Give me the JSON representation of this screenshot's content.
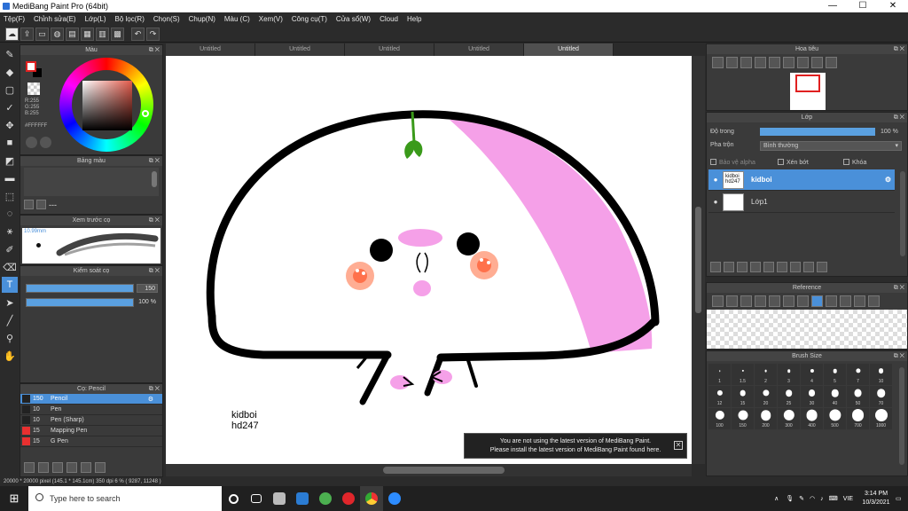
{
  "window": {
    "title": "MediBang Paint Pro (64bit)",
    "min": "—",
    "max": "☐",
    "close": "✕"
  },
  "menu": [
    "Tệp(F)",
    "Chỉnh sửa(E)",
    "Lớp(L)",
    "Bộ lọc(R)",
    "Chọn(S)",
    "Chụp(N)",
    "Màu (C)",
    "Xem(V)",
    "Công cụ(T)",
    "Cửa sổ(W)",
    "Cloud",
    "Help"
  ],
  "tabs": [
    "Untitled",
    "Untitled",
    "Untitled",
    "Untitled",
    "Untitled"
  ],
  "color_panel": {
    "title": "Màu",
    "rgb": "R:255\nG:255\nB:255",
    "hex": "#FFFFFF"
  },
  "palette_panel": {
    "title": "Bảng màu",
    "dash": "---"
  },
  "preview_panel": {
    "title": "Xem trước cọ",
    "size": "10.99mm"
  },
  "brush_control": {
    "title": "Kiểm soát cọ",
    "size_value": "150",
    "opacity_value": "100 %"
  },
  "brush_panel": {
    "title": "Cọ: Pencil",
    "brushes": [
      {
        "size": "150",
        "name": "Pencil",
        "color": "#222222",
        "selected": true
      },
      {
        "size": "10",
        "name": "Pen",
        "color": "#222222",
        "selected": false
      },
      {
        "size": "10",
        "name": "Pen (Sharp)",
        "color": "#222222",
        "selected": false
      },
      {
        "size": "15",
        "name": "Mapping Pen",
        "color": "#e83030",
        "selected": false
      },
      {
        "size": "15",
        "name": "G Pen",
        "color": "#e83030",
        "selected": false
      }
    ]
  },
  "canvas": {
    "signature_line1": "kidboi",
    "signature_line2": "hd247"
  },
  "notice": {
    "line1": "You are not using the latest version of MediBang Paint.",
    "line2": "Please install the latest version of MediBang Paint found here.",
    "close": "✕"
  },
  "navigator": {
    "title": "Hoa tiêu"
  },
  "layer_panel": {
    "title": "Lớp",
    "opacity_label": "Độ trong",
    "opacity_value": "100 %",
    "blend_label": "Pha trộn",
    "blend_value": "Bình thường",
    "protect_alpha": "Bảo vệ alpha",
    "clipping": "Xén bớt",
    "lock": "Khóa",
    "layers": [
      {
        "name": "kidboi",
        "thumb": "kidboi hd247",
        "selected": true
      },
      {
        "name": "Lớp1",
        "thumb": "",
        "selected": false
      }
    ]
  },
  "reference_panel": {
    "title": "Reference"
  },
  "brush_size_panel": {
    "title": "Brush Size",
    "sizes": [
      "1",
      "1.5",
      "2",
      "3",
      "4",
      "5",
      "7",
      "10",
      "12",
      "15",
      "20",
      "25",
      "30",
      "40",
      "50",
      "70",
      "100",
      "150",
      "200",
      "300",
      "400",
      "500",
      "700",
      "1000"
    ]
  },
  "status": {
    "text": "20000 * 20000 pixel   (145.1 * 145.1cm)   350 dpi   6 %   ( 9287, 11248 )"
  },
  "taskbar": {
    "search_placeholder": "Type here to search",
    "lang": "VIE",
    "time": "3:14 PM",
    "date": "10/3/2021"
  },
  "colors": {
    "accent": "#4a90d9",
    "blob_pink": "#f5a0e8",
    "sprout": "#3a9a1a"
  }
}
